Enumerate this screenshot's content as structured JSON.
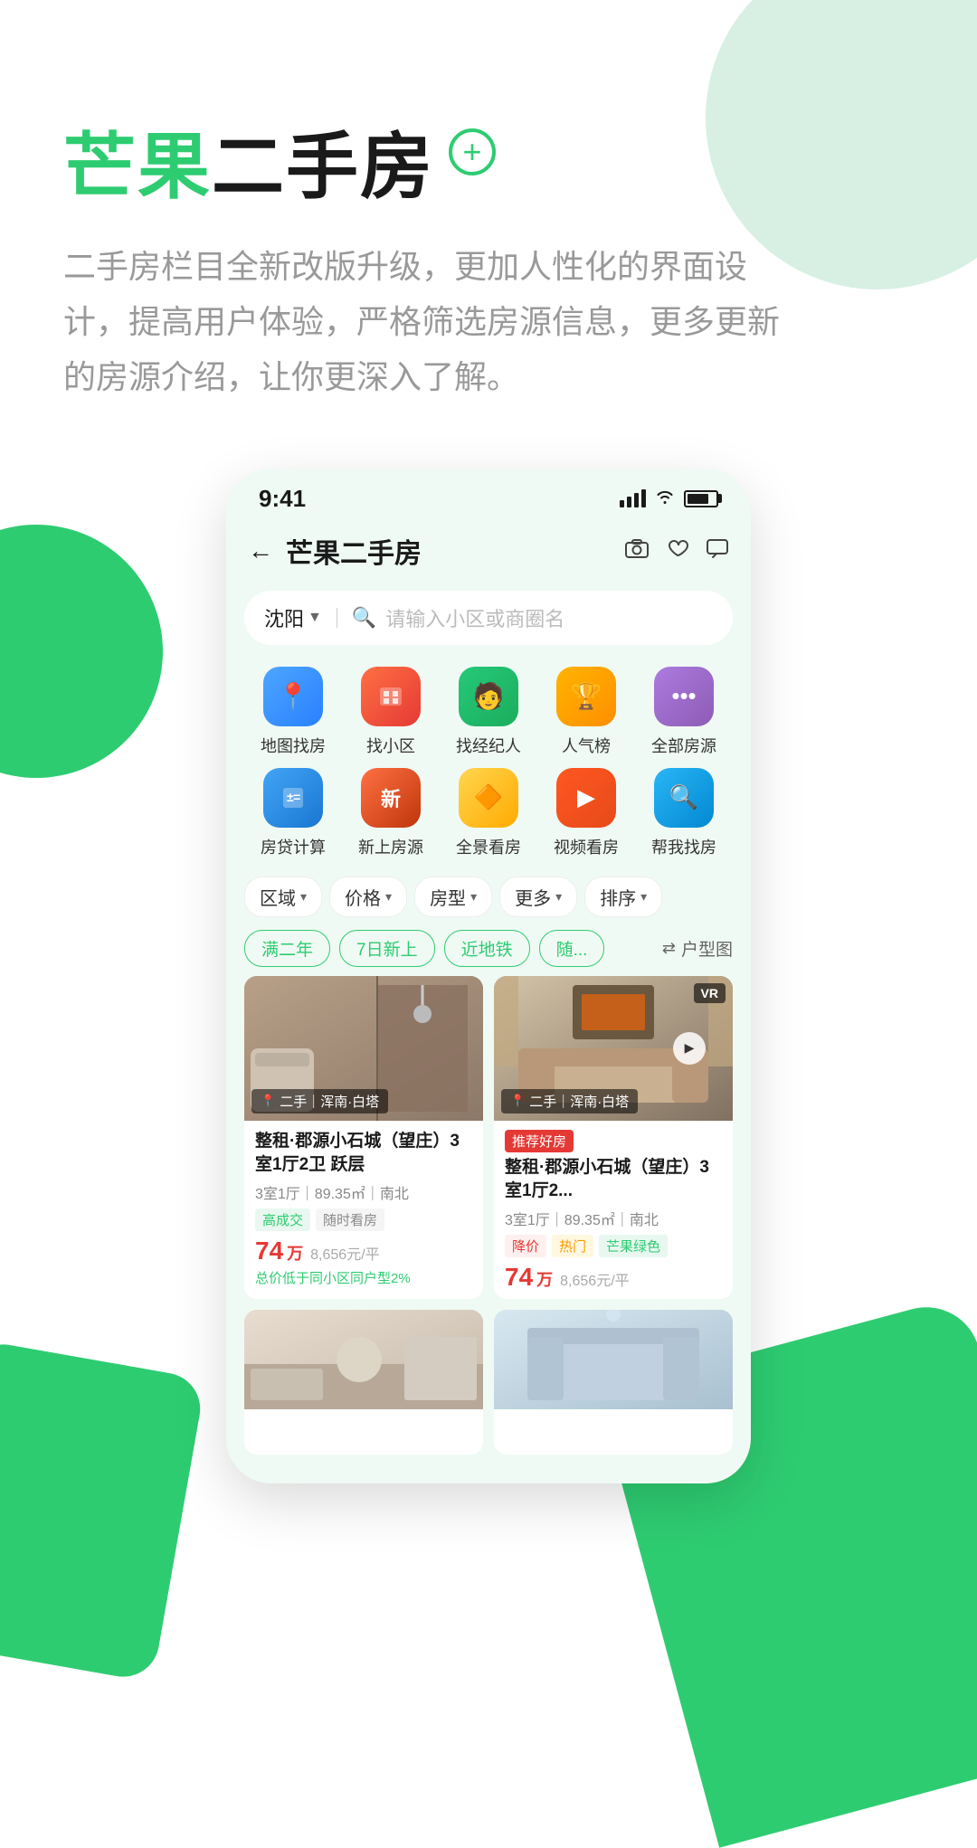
{
  "app": {
    "title_mango": "芒果",
    "title_rest": "二手房",
    "plus_icon": "+",
    "subtitle": "二手房栏目全新改版升级，更加人性化的界面设计，提高用户体验，严格筛选房源信息，更多更新的房源介绍，让你更深入了解。"
  },
  "phone": {
    "status_bar": {
      "time": "9:41",
      "signal": "●●●",
      "wifi": "wifi",
      "battery": "battery"
    },
    "nav": {
      "back_icon": "←",
      "title": "芒果二手房",
      "camera_icon": "📷",
      "heart_icon": "♡",
      "message_icon": "💬"
    },
    "search": {
      "location": "沈阳",
      "placeholder": "请输入小区或商圈名"
    },
    "quick_menu_row1": [
      {
        "label": "地图找房",
        "color_class": "blue",
        "icon": "📍"
      },
      {
        "label": "找小区",
        "color_class": "orange",
        "icon": "🏠"
      },
      {
        "label": "找经纪人",
        "color_class": "green",
        "icon": "👤"
      },
      {
        "label": "人气榜",
        "color_class": "yellow",
        "icon": "🏆"
      },
      {
        "label": "全部房源",
        "color_class": "purple",
        "icon": "⋯"
      }
    ],
    "quick_menu_row2": [
      {
        "label": "房贷计算",
        "color_class": "blue2",
        "icon": "="
      },
      {
        "label": "新上房源",
        "color_class": "orange2",
        "icon": "新"
      },
      {
        "label": "全景看房",
        "color_class": "amber",
        "icon": "🔶"
      },
      {
        "label": "视频看房",
        "color_class": "red-orange",
        "icon": "▶"
      },
      {
        "label": "帮我找房",
        "color_class": "cyan",
        "icon": "🔍"
      }
    ],
    "filters": [
      {
        "label": "区域"
      },
      {
        "label": "价格"
      },
      {
        "label": "房型"
      },
      {
        "label": "更多"
      },
      {
        "label": "排序"
      }
    ],
    "tags": [
      {
        "label": "满二年"
      },
      {
        "label": "7日新上"
      },
      {
        "label": "近地铁"
      },
      {
        "label": "随..."
      }
    ],
    "floor_plan_label": "户型图",
    "listings": [
      {
        "id": 1,
        "corner_tag": "二手 | 浑南·白塔",
        "recommended": false,
        "title": "整租·郡源小石城（望庄）3室1厅2卫 跃层",
        "specs": "3室1厅｜89.35㎡｜南北",
        "tags": [
          "高成交",
          "随时看房"
        ],
        "tag_styles": [
          "green",
          "gray"
        ],
        "price": "74",
        "price_unit": "万",
        "price_per": "8,656元/平",
        "price_note": "总价低于同小区同户型2%",
        "img_class": "bathroom",
        "has_vr": false,
        "has_play": false
      },
      {
        "id": 2,
        "corner_tag": "二手 | 浑南·白塔",
        "recommended": true,
        "recommended_text": "推荐好房",
        "title": "整租·郡源小石城（望庄）3室1厅2...",
        "specs": "3室1厅｜89.35㎡｜南北",
        "tags": [
          "降价",
          "热门",
          "芒果绿色"
        ],
        "tag_styles": [
          "red-text",
          "orange",
          "mango"
        ],
        "price": "74",
        "price_unit": "万",
        "price_per": "8,656元/平",
        "price_note": "",
        "img_class": "living",
        "has_vr": true,
        "has_play": true
      }
    ]
  }
}
